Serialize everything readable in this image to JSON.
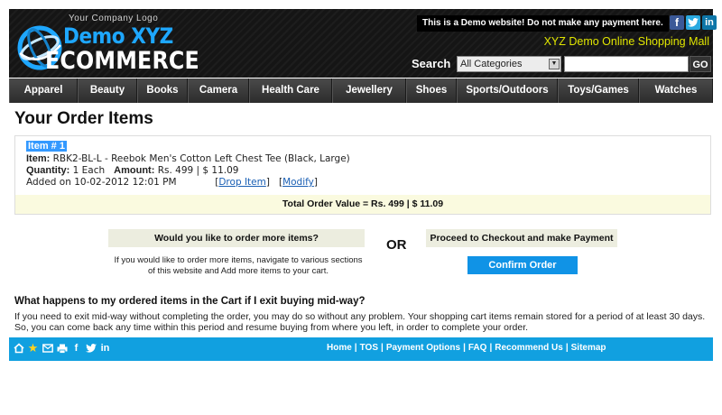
{
  "header": {
    "logo_tagline": "Your Company Logo",
    "logo_line1": "Demo XYZ",
    "logo_line2": "ECOMMERCE",
    "demo_notice": "This is a Demo website! Do not make any payment here.",
    "mall_title": "XYZ Demo Online Shopping Mall",
    "search_label": "Search",
    "search_category": "All Categories",
    "search_value": "",
    "go_label": "GO",
    "social": [
      {
        "icon": "facebook-icon",
        "glyph": "f"
      },
      {
        "icon": "twitter-icon",
        "glyph": "t"
      },
      {
        "icon": "linkedin-icon",
        "glyph": "in"
      }
    ]
  },
  "nav": {
    "items": [
      "Apparel",
      "Beauty",
      "Books",
      "Camera",
      "Health Care",
      "Jewellery",
      "Shoes",
      "Sports/Outdoors",
      "Toys/Games",
      "Watches"
    ]
  },
  "page": {
    "title": "Your Order Items"
  },
  "order": {
    "item_number": "Item # 1",
    "item_label": "Item:",
    "item_value": "RBK2-BL-L - Reebok Men's Cotton Left Chest Tee (Black, Large)",
    "quantity_label": "Quantity:",
    "quantity_value": "1 Each",
    "amount_label": "Amount:",
    "amount_value": "Rs. 499 | $ 11.09",
    "added_on": "Added on 10-02-2012 12:01 PM",
    "drop_link": "Drop Item",
    "modify_link": "Modify",
    "total": "Total Order Value = Rs. 499 | $ 11.09"
  },
  "cta": {
    "more_items_heading": "Would you like to order more items?",
    "more_items_desc": "If you would like to order more items, navigate to various sections of this website and Add more items to your cart.",
    "or_label": "OR",
    "checkout_heading": "Proceed to Checkout and make Payment",
    "confirm_label": "Confirm Order"
  },
  "faq": {
    "question": "What happens to my ordered items in the Cart if I exit buying mid-way?",
    "answer": "If you need to exit mid-way without completing the order, you may do so without any problem. Your shopping cart items remain stored for a period of at least 30 days. So, you can come back any time within this period and resume buying from where you left, in order to complete your order."
  },
  "footer": {
    "icons": [
      "home-icon",
      "star-icon",
      "mail-icon",
      "print-icon",
      "facebook-icon",
      "twitter-icon",
      "linkedin-icon"
    ],
    "links": [
      "Home",
      "TOS",
      "Payment Options",
      "FAQ",
      "Recommend Us",
      "Sitemap"
    ]
  },
  "colors": {
    "header_bg": "#151515",
    "brand_blue": "#1ea7ff",
    "mall_title": "#e1e600",
    "nav_bg": "#3a3a3a",
    "footer_bg": "#11a0e0",
    "confirm_button": "#1093e6",
    "item_highlight": "#3399ff",
    "total_bg": "#fafadf"
  }
}
